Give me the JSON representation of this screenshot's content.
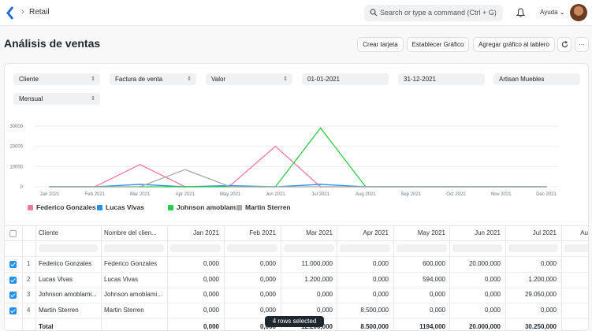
{
  "nav": {
    "breadcrumb": "Retail",
    "search_placeholder": "Search or type a command (Ctrl + G)",
    "help": "Ayuda"
  },
  "page": {
    "title": "Análisis de ventas"
  },
  "toolbar": {
    "create_card": "Crear tarjeta",
    "set_chart": "Establecer Gráfico",
    "add_to_dashboard": "Agregar gráfico al tablero",
    "refresh_icon": "refresh-icon",
    "more_icon": "more-icon"
  },
  "filters": {
    "tree_type": "Cliente",
    "doc_type": "Factura de venta",
    "value_quantity": "Valor",
    "from_date": "01-01-2021",
    "to_date": "31-12-2021",
    "company": "Artisan Muebles",
    "range": "Mensual"
  },
  "chart_data": {
    "type": "line",
    "x": [
      "Jan 2021",
      "Feb 2021",
      "Mar 2021",
      "Apr 2021",
      "May 2021",
      "Jun 2021",
      "Jul 2021",
      "Aug 2021",
      "Sep 2021",
      "Oct 2021",
      "Nov 2021",
      "Dec 2021"
    ],
    "y_ticks": [
      "30000",
      "20000",
      "10000",
      "0"
    ],
    "ylim": [
      0,
      30000
    ],
    "series": [
      {
        "name": "Federico Gonzales",
        "color": "#f278a3",
        "values": [
          0,
          0,
          11000,
          0,
          600,
          20000,
          0,
          0,
          0,
          0,
          0,
          0
        ]
      },
      {
        "name": "Lucas Vivas",
        "color": "#2490ef",
        "values": [
          0,
          0,
          1200,
          0,
          594,
          0,
          1200,
          0,
          0,
          0,
          0,
          0
        ]
      },
      {
        "name": "Johnson amoblam...",
        "color": "#29cd42",
        "values": [
          0,
          0,
          0,
          0,
          0,
          0,
          29050,
          0,
          0,
          0,
          0,
          0
        ]
      },
      {
        "name": "Martin Sterren",
        "color": "#a8a8a8",
        "values": [
          0,
          0,
          0,
          8500,
          0,
          0,
          0,
          0,
          0,
          0,
          0,
          0
        ]
      }
    ]
  },
  "table": {
    "headers": [
      "Cliente",
      "Nombre del clien...",
      "Jan 2021",
      "Feb 2021",
      "Mar 2021",
      "Apr 2021",
      "May 2021",
      "Jun 2021",
      "Jul 2021",
      "Au"
    ],
    "rows": [
      {
        "idx": "1",
        "cliente": "Federico Gonzales",
        "nombre": "Federico Gonzales",
        "vals": [
          "0,000",
          "0,000",
          "11.000,000",
          "0,000",
          "600,000",
          "20.000,000",
          "0,000"
        ]
      },
      {
        "idx": "2",
        "cliente": "Lucas Vivas",
        "nombre": "Lucas Vivas",
        "vals": [
          "0,000",
          "0,000",
          "1.200,000",
          "0,000",
          "594,000",
          "0,000",
          "1.200,000"
        ]
      },
      {
        "idx": "3",
        "cliente": "Johnson amoblami...",
        "nombre": "Johnson amoblami...",
        "vals": [
          "0,000",
          "0,000",
          "0,000",
          "0,000",
          "0,000",
          "0,000",
          "29.050,000"
        ]
      },
      {
        "idx": "4",
        "cliente": "Martin Sterren",
        "nombre": "Martin Sterren",
        "vals": [
          "0,000",
          "0,000",
          "0,000",
          "8.500,000",
          "0,000",
          "0,000",
          "0,000"
        ]
      }
    ],
    "total_label": "Total",
    "total_vals": [
      "0,000",
      "0,000",
      "12.200,000",
      "8.500,000",
      "1194,000",
      "20.000,000",
      "30.250,000"
    ]
  },
  "status": {
    "selected": "4 rows selected"
  }
}
